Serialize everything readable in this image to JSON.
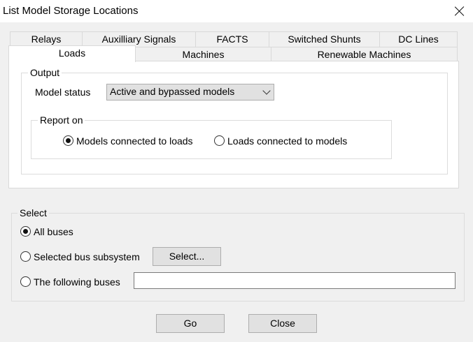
{
  "window": {
    "title": "List Model Storage Locations"
  },
  "tabs_row1": [
    "Relays",
    "Auxilliary Signals",
    "FACTS",
    "Switched Shunts",
    "DC Lines"
  ],
  "tabs_row2": [
    "Loads",
    "Machines",
    "Renewable Machines"
  ],
  "active_tab": "Loads",
  "output": {
    "label": "Output",
    "model_status_label": "Model status",
    "model_status_value": "Active and bypassed models",
    "report_on": {
      "label": "Report on",
      "option1": "Models connected to loads",
      "option2": "Loads connected to models",
      "selected": "Models connected to loads"
    }
  },
  "select": {
    "label": "Select",
    "all_buses": "All buses",
    "selected_subsystem": "Selected bus subsystem",
    "select_button": "Select...",
    "following_buses": "The following buses",
    "following_buses_value": "",
    "selected": "All buses"
  },
  "buttons": {
    "go": "Go",
    "close": "Close"
  }
}
